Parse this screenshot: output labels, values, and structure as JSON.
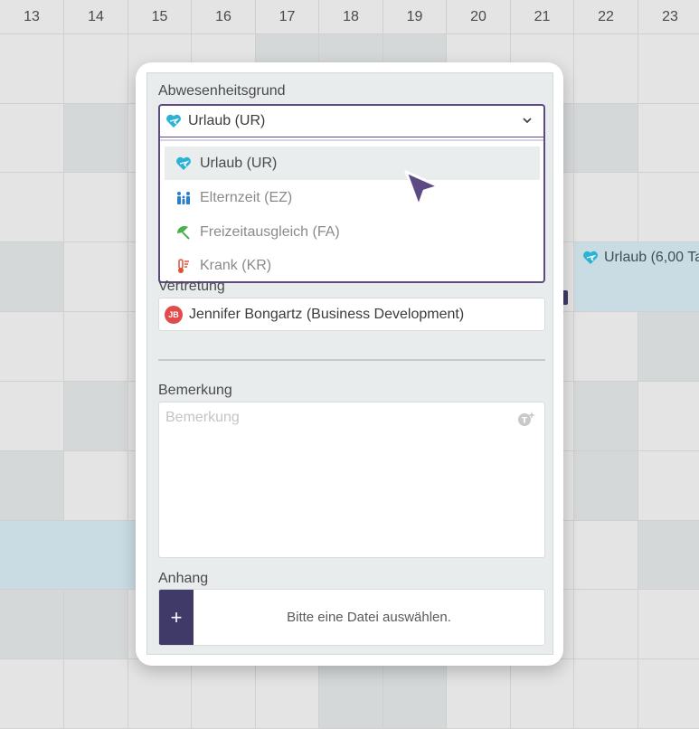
{
  "calendar": {
    "days": [
      "13",
      "14",
      "15",
      "16",
      "17",
      "18",
      "19",
      "20",
      "21",
      "22",
      "23"
    ],
    "event_label": "Urlaub (6,00 Ta"
  },
  "form": {
    "reason_label": "Abwesenheitsgrund",
    "reason_selected": "Urlaub (UR)",
    "reason_options": [
      {
        "label": "Urlaub (UR)",
        "icon": "heart-plane-icon",
        "color": "#2ab3d4"
      },
      {
        "label": "Elternzeit (EZ)",
        "icon": "family-icon",
        "color": "#2a7fc6"
      },
      {
        "label": "Freizeitausgleich (FA)",
        "icon": "umbrella-icon",
        "color": "#4caf50"
      },
      {
        "label": "Krank (KR)",
        "icon": "thermometer-icon",
        "color": "#e0503a"
      }
    ],
    "substitute_label": "Vertretung",
    "substitute_initials": "JB",
    "substitute_value": "Jennifer Bongartz (Business Development)",
    "remark_label": "Bemerkung",
    "remark_placeholder": "Bemerkung",
    "attachment_label": "Anhang",
    "attachment_button": "+",
    "attachment_text": "Bitte eine Datei auswählen."
  },
  "colors": {
    "accent": "#5b4a84",
    "button": "#3f3a68",
    "event": "#c9dce3"
  }
}
